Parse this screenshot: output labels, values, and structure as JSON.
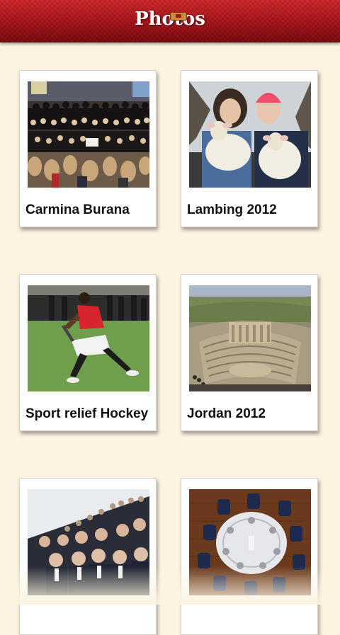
{
  "header": {
    "title": "Photos",
    "crest_icon": "school-crest-icon",
    "background_color": "#b81b22"
  },
  "albums": [
    {
      "caption": "Carmina Burana"
    },
    {
      "caption": "Lambing 2012"
    },
    {
      "caption": "Sport relief Hockey"
    },
    {
      "caption": "Jordan 2012"
    },
    {
      "caption": ""
    },
    {
      "caption": ""
    }
  ],
  "colors": {
    "page_background": "#fcf3e1",
    "card_background": "#ffffff",
    "caption_text": "#111111"
  }
}
